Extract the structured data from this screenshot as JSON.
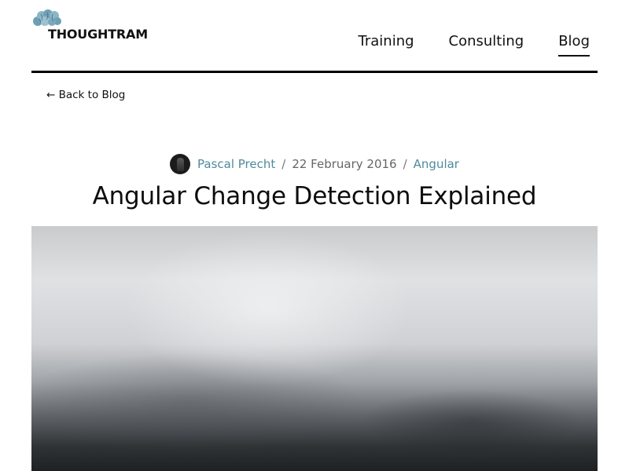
{
  "brand": {
    "name": "THOUGHTRAM"
  },
  "nav": {
    "items": [
      {
        "label": "Training"
      },
      {
        "label": "Consulting"
      },
      {
        "label": "Blog",
        "active": true
      }
    ]
  },
  "back_link": {
    "label": "← Back to Blog"
  },
  "post": {
    "author": "Pascal Precht",
    "date": "22 February 2016",
    "category": "Angular",
    "separator": "/",
    "title": "Angular Change Detection Explained"
  },
  "colors": {
    "link_accent": "#4f8a9c",
    "rule": "#000000",
    "logo_blue": "#6e9fb4"
  },
  "icons": {
    "logo": "brain-logo-icon",
    "avatar": "author-avatar"
  }
}
